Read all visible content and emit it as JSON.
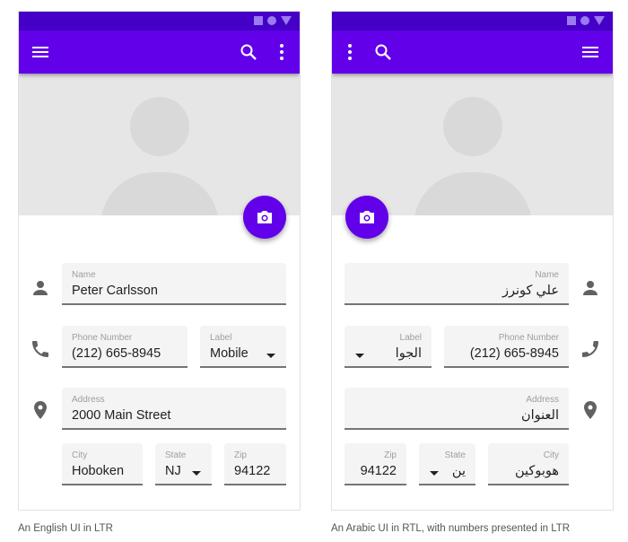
{
  "colors": {
    "primary": "#6200ea",
    "status_bar": "#4500c8",
    "hero_bg": "#e6e6e6"
  },
  "ltr_screen": {
    "direction": "ltr",
    "appbar": {
      "left_icon": "menu-icon",
      "right_icons": [
        "search-icon",
        "more-vert-icon"
      ]
    },
    "fab_icon": "camera-icon",
    "fields": {
      "name": {
        "label": "Name",
        "value": "Peter Carlsson",
        "icon": "person-icon"
      },
      "phone": {
        "label": "Phone Number",
        "value": "(212) 665-8945",
        "icon": "phone-icon"
      },
      "phone_label": {
        "label": "Label",
        "value": "Mobile"
      },
      "address": {
        "label": "Address",
        "value": "2000 Main Street",
        "icon": "location-pin-icon"
      },
      "city": {
        "label": "City",
        "value": "Hoboken"
      },
      "state": {
        "label": "State",
        "value": "NJ"
      },
      "zip": {
        "label": "Zip",
        "value": "94122"
      }
    },
    "caption": "An English UI in LTR"
  },
  "rtl_screen": {
    "direction": "rtl",
    "appbar": {
      "left_icons": [
        "more-vert-icon",
        "search-icon"
      ],
      "right_icon": "menu-icon"
    },
    "fab_icon": "camera-icon",
    "fields": {
      "name": {
        "label": "Name",
        "value": "علي كونرز",
        "icon": "person-icon"
      },
      "phone": {
        "label": "Phone Number",
        "value": "(212) 665-8945",
        "icon": "phone-icon"
      },
      "phone_label": {
        "label": "Label",
        "value": "الجوا"
      },
      "address": {
        "label": "Address",
        "value": "العنوان",
        "icon": "location-pin-icon"
      },
      "city": {
        "label": "City",
        "value": "هوبوكين"
      },
      "state": {
        "label": "State",
        "value": "ين"
      },
      "zip": {
        "label": "Zip",
        "value": "94122"
      }
    },
    "caption": "An Arabic UI in RTL, with numbers presented in LTR"
  }
}
